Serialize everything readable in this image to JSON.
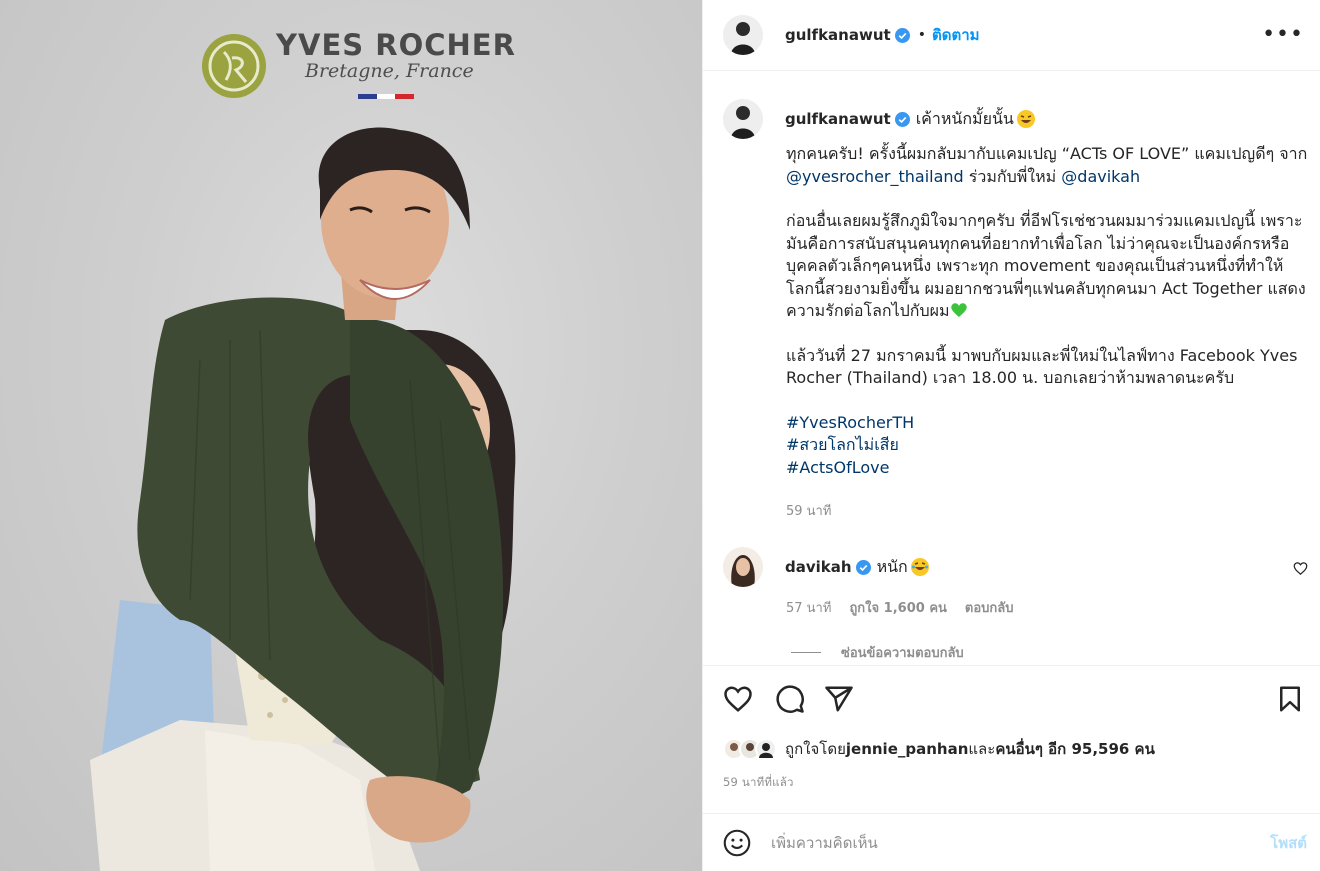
{
  "brand": {
    "logo_name": "YVES ROCHER",
    "logo_tagline": "Bretagne, France",
    "colors": {
      "logo_green": "#9aa33f",
      "flag_blue": "#2a3f8f",
      "flag_white": "#ffffff",
      "flag_red": "#d2282e"
    }
  },
  "header": {
    "username": "gulfkanawut",
    "separator": "•",
    "follow_label": "ติดตาม",
    "more_label": "•••"
  },
  "caption": {
    "username": "gulfkanawut",
    "intro": "เค้าหนักมั้ยนั้น",
    "p1_a": "ทุกคนครับ! ครั้งนี้ผมกลับมากับแคมเปญ “ACTs OF LOVE” แคมเปญดีๆ จาก ",
    "p1_mention1": "@yvesrocher_thailand",
    "p1_b": " ร่วมกับพี่ใหม่ ",
    "p1_mention2": "@davikah",
    "p2": "ก่อนอื่นเลยผมรู้สึกภูมิใจมากๆครับ ที่อีฟโรเช่ชวนผมมาร่วมแคมเปญนี้ เพราะมันคือการสนับสนุนคนทุกคนที่อยากทำเพื่อโลก ไม่ว่าคุณจะเป็นองค์กรหรือบุคคลตัวเล็กๆคนหนึ่ง เพราะทุก movement ของคุณเป็นส่วนหนึ่งที่ทำให้โลกนี้สวยงามยิ่งขึ้น ผมอยากชวนพี่ๆแฟนคลับทุกคนมา Act Together แสดงความรักต่อโลกไปกับผม",
    "p3": "แล้ววันที่ 27 มกราคมนี้ มาพบกับผมและพี่ใหม่ในไลฟ์ทาง Facebook Yves Rocher (Thailand) เวลา 18.00 น. บอกเลยว่าห้ามพลาดนะครับ",
    "hashtags": [
      "#YvesRocherTH",
      "#สวยโลกไม่เสีย",
      "#ActsOfLove"
    ],
    "time": "59 นาที"
  },
  "reply": {
    "username": "davikah",
    "text": "หนัก",
    "time": "57 นาที",
    "likes": "ถูกใจ 1,600 คน",
    "reply_label": "ตอบกลับ",
    "hide_replies": "ซ่อนข้อความตอบกลับ"
  },
  "actions": {
    "icons": [
      "heart-icon",
      "comment-icon",
      "share-icon",
      "bookmark-icon"
    ]
  },
  "likes": {
    "prefix": "ถูกใจโดย ",
    "user": "jennie_panhan",
    "mid": " และ ",
    "others": "คนอื่นๆ อีก 95,596 คน"
  },
  "post_time": "59 นาทีที่แล้ว",
  "add_comment": {
    "placeholder": "เพิ่มความคิดเห็น",
    "post_label": "โพสต์"
  },
  "colors": {
    "link": "#00376b",
    "accent": "#0095f6",
    "muted": "#8e8e8e",
    "verified": "#3897f0"
  }
}
